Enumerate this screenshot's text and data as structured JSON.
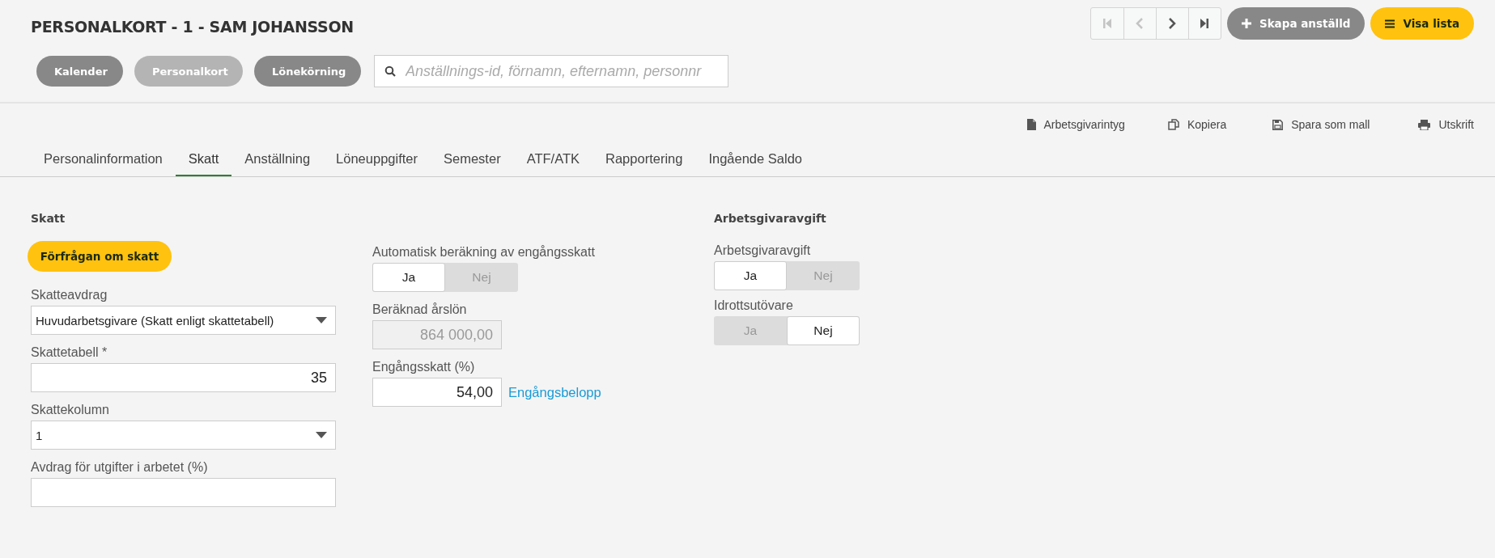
{
  "header": {
    "title": "PERSONALKORT - 1 - SAM JOHANSSON",
    "nav_buttons": [
      {
        "kind": "first",
        "disabled": true
      },
      {
        "kind": "prev",
        "disabled": true
      },
      {
        "kind": "next",
        "disabled": false
      },
      {
        "kind": "last",
        "disabled": false
      }
    ],
    "create_button": "Skapa anställd",
    "list_button": "Visa lista",
    "view_buttons": [
      {
        "label": "Kalender",
        "selected": false
      },
      {
        "label": "Personalkort",
        "selected": true
      },
      {
        "label": "Lönekörning",
        "selected": false
      }
    ],
    "search": {
      "placeholder": "Anställnings-id, förnamn, efternamn, personnr"
    }
  },
  "actions": [
    {
      "kind": "document",
      "label": "Arbetsgivarintyg"
    },
    {
      "kind": "copy",
      "label": "Kopiera"
    },
    {
      "kind": "save",
      "label": "Spara som mall"
    },
    {
      "kind": "print",
      "label": "Utskrift"
    }
  ],
  "tabs": [
    {
      "label": "Personalinformation",
      "selected": false
    },
    {
      "label": "Skatt",
      "selected": true
    },
    {
      "label": "Anställning",
      "selected": false
    },
    {
      "label": "Löneuppgifter",
      "selected": false
    },
    {
      "label": "Semester",
      "selected": false
    },
    {
      "label": "ATF/ATK",
      "selected": false
    },
    {
      "label": "Rapportering",
      "selected": false
    },
    {
      "label": "Ingående Saldo",
      "selected": false
    }
  ],
  "tax": {
    "heading": "Skatt",
    "request_button": "Förfrågan om skatt",
    "fields": [
      {
        "kind": "select",
        "label": "Skatteavdrag",
        "value": "Huvudarbetsgivare (Skatt enligt skattetabell)"
      },
      {
        "kind": "input",
        "label": "Skattetabell *",
        "value": "35"
      },
      {
        "kind": "select",
        "label": "Skattekolumn",
        "value": "1"
      },
      {
        "kind": "input",
        "label": "Avdrag för utgifter i arbetet (%)"
      }
    ]
  },
  "one_time_tax": {
    "toggle": {
      "label": "Automatisk beräkning av engångsskatt",
      "options": [
        {
          "label": "Ja",
          "selected": true
        },
        {
          "label": "Nej",
          "selected": false
        }
      ]
    },
    "annual_salary": {
      "label": "Beräknad årslön",
      "value": "864 000,00",
      "disabled": true
    },
    "rate": {
      "label": "Engångsskatt (%)",
      "value": "54,00",
      "disabled": false,
      "link": "Engångsbelopp"
    }
  },
  "employer_fee": {
    "heading": "Arbetsgivaravgift",
    "toggles": [
      {
        "label": "Arbetsgivaravgift",
        "options": [
          {
            "label": "Ja",
            "selected": true
          },
          {
            "label": "Nej",
            "selected": false
          }
        ]
      },
      {
        "label": "Idrottsutövare",
        "options": [
          {
            "label": "Ja",
            "selected": false
          },
          {
            "label": "Nej",
            "selected": true
          }
        ]
      }
    ]
  }
}
